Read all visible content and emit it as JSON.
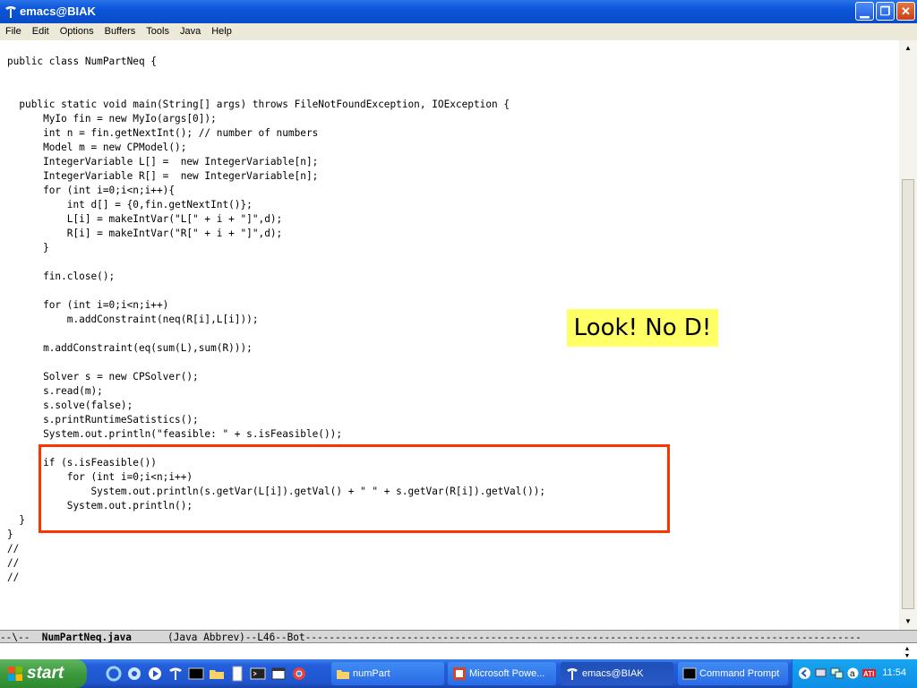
{
  "window": {
    "title": "emacs@BIAK"
  },
  "menu": {
    "items": [
      "File",
      "Edit",
      "Options",
      "Buffers",
      "Tools",
      "Java",
      "Help"
    ]
  },
  "editor": {
    "lines": [
      "public class NumPartNeq {",
      "",
      "",
      "  public static void main(String[] args) throws FileNotFoundException, IOException {",
      "      MyIo fin = new MyIo(args[0]);",
      "      int n = fin.getNextInt(); // number of numbers",
      "      Model m = new CPModel();",
      "      IntegerVariable L[] =  new IntegerVariable[n];",
      "      IntegerVariable R[] =  new IntegerVariable[n];",
      "      for (int i=0;i<n;i++){",
      "          int d[] = {0,fin.getNextInt()};",
      "          L[i] = makeIntVar(\"L[\" + i + \"]\",d);",
      "          R[i] = makeIntVar(\"R[\" + i + \"]\",d);",
      "      }",
      "",
      "      fin.close();",
      "",
      "      for (int i=0;i<n;i++)",
      "          m.addConstraint(neq(R[i],L[i]));",
      "",
      "      m.addConstraint(eq(sum(L),sum(R)));",
      "",
      "      Solver s = new CPSolver();",
      "      s.read(m);",
      "      s.solve(false);",
      "      s.printRuntimeSatistics();",
      "      System.out.println(\"feasible: \" + s.isFeasible());",
      "",
      "      if (s.isFeasible())",
      "          for (int i=0;i<n;i++)",
      "              System.out.println(s.getVar(L[i]).getVal() + \" \" + s.getVar(R[i]).getVal());",
      "          System.out.println();",
      "  }",
      "}",
      "//",
      "//",
      "//"
    ]
  },
  "callout": {
    "text": "Look! No D!"
  },
  "modeline": {
    "prefix": "--\\--  ",
    "buffer": "NumPartNeq.java",
    "mode": "      (Java Abbrev)--L46--Bot---------------------------------------------------------------------------------------------"
  },
  "taskbar": {
    "start_label": "start",
    "tasks": [
      "numPart",
      "Microsoft Powe...",
      "emacs@BIAK",
      "Command Prompt"
    ],
    "clock": "11:54"
  },
  "icons": {
    "app": "emacs-gnu-icon",
    "minimize": "minimize-icon",
    "maximize": "restore-icon",
    "close": "close-icon"
  },
  "colors": {
    "titlebar": "#0a55d9",
    "callout_bg": "#ffff66",
    "highlight_border": "#ff3300",
    "taskbar": "#245edb"
  }
}
